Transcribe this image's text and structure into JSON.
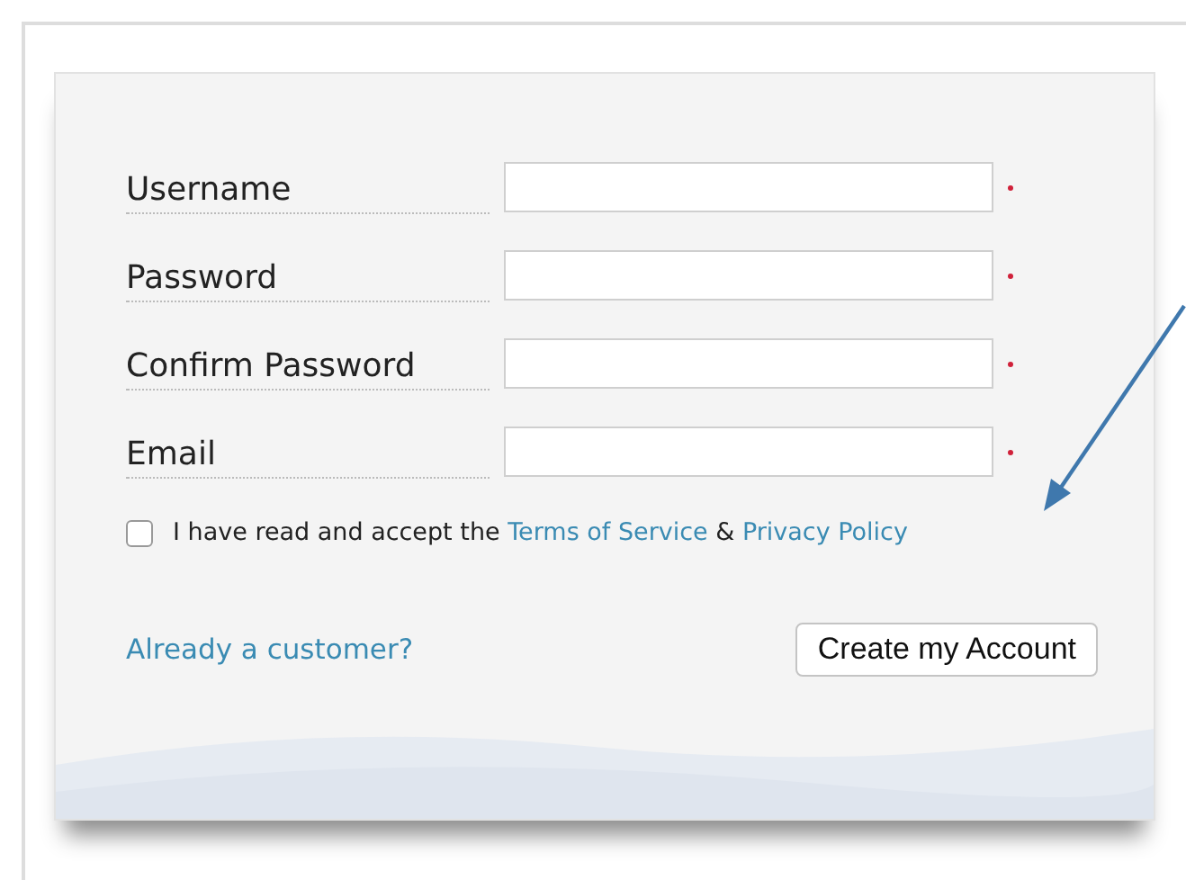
{
  "fields": [
    {
      "label": "Username",
      "required": true
    },
    {
      "label": "Password",
      "required": true
    },
    {
      "label": "Confirm Password",
      "required": true
    },
    {
      "label": "Email",
      "required": true
    }
  ],
  "agreement": {
    "checked": false,
    "text": "I have read and accept the",
    "terms_link": "Terms of Service",
    "joiner": "&",
    "privacy_link": "Privacy Policy"
  },
  "login_link": "Already a customer?",
  "submit_button": "Create my Account"
}
